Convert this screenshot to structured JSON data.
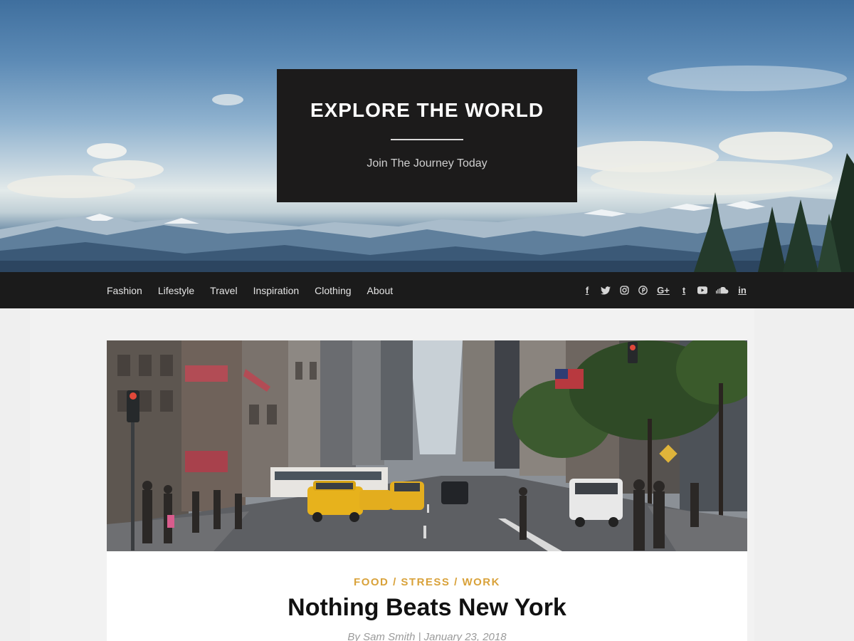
{
  "header": {
    "site_title": "EXPLORE THE WORLD",
    "tagline": "Join The Journey Today"
  },
  "nav": {
    "items": [
      {
        "label": "Fashion"
      },
      {
        "label": "Lifestyle"
      },
      {
        "label": "Travel"
      },
      {
        "label": "Inspiration"
      },
      {
        "label": "Clothing"
      },
      {
        "label": "About"
      }
    ],
    "social": [
      {
        "icon": "facebook-icon",
        "glyph": "f"
      },
      {
        "icon": "twitter-icon",
        "glyph": ""
      },
      {
        "icon": "instagram-icon",
        "glyph": ""
      },
      {
        "icon": "pinterest-icon",
        "glyph": ""
      },
      {
        "icon": "google-plus-icon",
        "glyph": "G+"
      },
      {
        "icon": "tumblr-icon",
        "glyph": "t"
      },
      {
        "icon": "youtube-icon",
        "glyph": ""
      },
      {
        "icon": "soundcloud-icon",
        "glyph": ""
      },
      {
        "icon": "linkedin-icon",
        "glyph": "in"
      }
    ]
  },
  "post": {
    "categories": [
      "FOOD",
      "STRESS",
      "WORK"
    ],
    "category_separator": "/",
    "title": "Nothing Beats New York",
    "byline": "By Sam Smith | January 23, 2018"
  },
  "colors": {
    "category_accent": "#d9a23a",
    "nav_background": "#1b1b1b",
    "title_box_background": "#1c1b1b"
  }
}
